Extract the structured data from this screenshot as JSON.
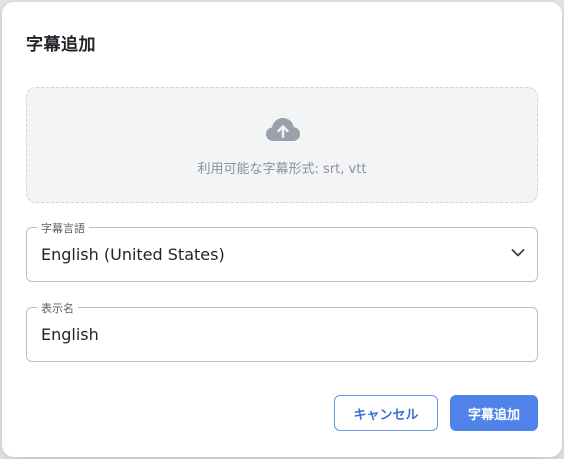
{
  "dialog": {
    "title": "字幕追加",
    "dropzone": {
      "icon": "cloud-upload-icon",
      "hint": "利用可能な字幕形式: srt, vtt"
    },
    "language_field": {
      "legend": "字幕言語",
      "value": "English (United States)",
      "icon": "chevron-down-icon"
    },
    "display_name_field": {
      "legend": "表示名",
      "value": "English"
    },
    "buttons": {
      "cancel_label": "キャンセル",
      "add_label": "字幕追加"
    },
    "colors": {
      "primary": "#4f83ea",
      "primary_text": "#3b6fd8",
      "dropzone_bg": "#f3f4f6",
      "icon_gray": "#9aa1ab"
    }
  }
}
